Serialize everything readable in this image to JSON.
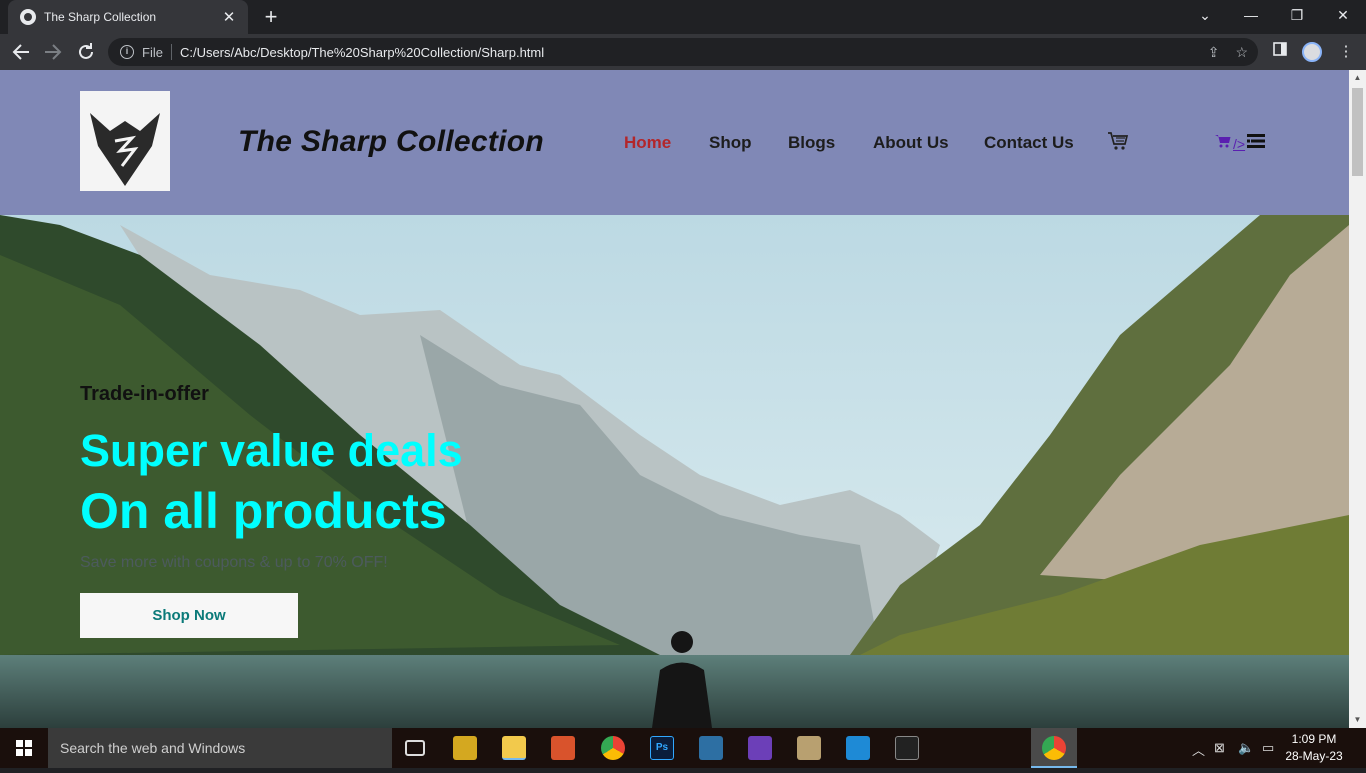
{
  "browser": {
    "tab_title": "The Sharp Collection",
    "tab_close": "✕",
    "new_tab": "+",
    "file_label": "File",
    "url": "C:/Users/Abc/Desktop/The%20Sharp%20Collection/Sharp.html",
    "window_controls": {
      "collapse": "⌄",
      "minimize": "—",
      "restore": "❐",
      "close": "✕"
    }
  },
  "site": {
    "brand": "The Sharp Collection",
    "nav": [
      "Home",
      "Shop",
      "Blogs",
      "About Us",
      "Contact Us"
    ],
    "active_nav": "Home",
    "mobile_nav_text": "/>",
    "hero": {
      "eyebrow": "Trade-in-offer",
      "heading_line1": "Super value deals",
      "heading_line2": "On all products",
      "subtext": "Save more with coupons & up to 70% OFF!",
      "button": "Shop Now"
    }
  },
  "colors": {
    "header_bg": "#8088b6",
    "nav_active": "#b3262a",
    "hero_heading": "#00ffff",
    "button_text": "#0b7a79"
  },
  "taskbar": {
    "search_placeholder": "Search the web and Windows",
    "time": "1:09 PM",
    "date": "28-May-23",
    "apps": [
      "task-view",
      "file-archiver",
      "file-explorer",
      "presentation",
      "chrome",
      "photoshop",
      "text-editor",
      "visual-studio",
      "tools",
      "vscode",
      "terminal",
      "chrome-active"
    ]
  }
}
